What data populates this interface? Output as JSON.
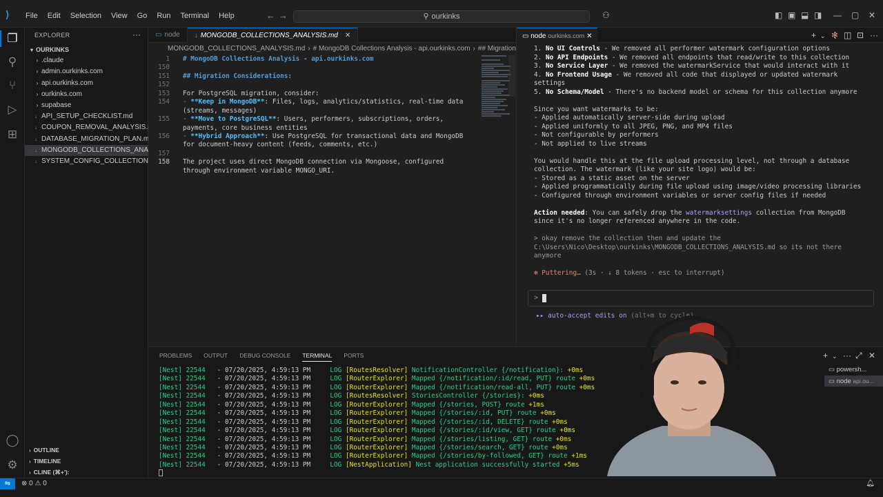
{
  "titlebar": {
    "menus": [
      "File",
      "Edit",
      "Selection",
      "View",
      "Go",
      "Run",
      "Terminal",
      "Help"
    ],
    "search": "ourkinks"
  },
  "sidebar": {
    "header": "EXPLORER",
    "root": "OURKINKS",
    "items": [
      {
        "label": ".claude",
        "type": "folder"
      },
      {
        "label": "admin.ourkinks.com",
        "type": "folder"
      },
      {
        "label": "api.ourkinks.com",
        "type": "folder"
      },
      {
        "label": "ourkinks.com",
        "type": "folder"
      },
      {
        "label": "supabase",
        "type": "folder"
      },
      {
        "label": "API_SETUP_CHECKLIST.md",
        "type": "file"
      },
      {
        "label": "COUPON_REMOVAL_ANALYSIS.md",
        "type": "file"
      },
      {
        "label": "DATABASE_MIGRATION_PLAN.md",
        "type": "file"
      },
      {
        "label": "MONGODB_COLLECTIONS_ANALY...",
        "type": "file",
        "selected": true
      },
      {
        "label": "SYSTEM_CONFIG_COLLECTIONS_A...",
        "type": "file"
      }
    ],
    "outline": "OUTLINE",
    "timeline": "TIMELINE",
    "cline": "CLINE (⌘+'):"
  },
  "editor": {
    "tabs": [
      {
        "label": "node",
        "active": false
      },
      {
        "label": "MONGODB_COLLECTIONS_ANALYSIS.md",
        "active": true
      }
    ],
    "breadcrumb": [
      "MONGODB_COLLECTIONS_ANALYSIS.md",
      "# MongoDB Collections Analysis - api.ourkinks.com",
      "## Migration C"
    ],
    "lines": [
      {
        "n": "1",
        "parts": [
          [
            "h",
            "# MongoDB Collections Analysis - api.ourkinks.com"
          ]
        ]
      },
      {
        "n": "150",
        "parts": [
          [
            "t",
            ""
          ]
        ]
      },
      {
        "n": "151",
        "parts": [
          [
            "h",
            "## Migration Considerations:"
          ]
        ]
      },
      {
        "n": "152",
        "parts": [
          [
            "t",
            ""
          ]
        ]
      },
      {
        "n": "153",
        "parts": [
          [
            "t",
            "For PostgreSQL migration, consider:"
          ]
        ]
      },
      {
        "n": "154",
        "parts": [
          [
            "b",
            "- "
          ],
          [
            "bold",
            "**Keep in MongoDB**"
          ],
          [
            "t",
            ": Files, logs, analytics/statistics, real-time data"
          ]
        ]
      },
      {
        "n": "",
        "parts": [
          [
            "t",
            "(streams, messages)"
          ]
        ]
      },
      {
        "n": "155",
        "parts": [
          [
            "b",
            "- "
          ],
          [
            "bold",
            "**Move to PostgreSQL**"
          ],
          [
            "t",
            ": Users, performers, subscriptions, orders,"
          ]
        ]
      },
      {
        "n": "",
        "parts": [
          [
            "t",
            "payments, core business entities"
          ]
        ]
      },
      {
        "n": "156",
        "parts": [
          [
            "b",
            "- "
          ],
          [
            "bold",
            "**Hybrid Approach**"
          ],
          [
            "t",
            ": Use PostgreSQL for transactional data and MongoDB"
          ]
        ]
      },
      {
        "n": "",
        "parts": [
          [
            "t",
            "for document-heavy content (feeds, comments, etc.)"
          ]
        ]
      },
      {
        "n": "157",
        "parts": [
          [
            "t",
            ""
          ]
        ]
      },
      {
        "n": "158",
        "cur": true,
        "parts": [
          [
            "t",
            "The project uses direct MongoDB connection via Mongoose, configured"
          ]
        ]
      },
      {
        "n": "",
        "parts": [
          [
            "t",
            "through environment variable MONGO_URI."
          ]
        ]
      }
    ]
  },
  "right_terminal": {
    "tab_label": "node",
    "tab_sub": "ourkinks.com",
    "lines": [
      [
        [
          "t",
          "1. "
        ],
        [
          "b",
          "No UI Controls"
        ],
        [
          "t",
          " - We removed all performer watermark configuration options"
        ]
      ],
      [
        [
          "t",
          "2. "
        ],
        [
          "b",
          "No API Endpoints"
        ],
        [
          "t",
          " - We removed all endpoints that read/write to this collection"
        ]
      ],
      [
        [
          "t",
          "3. "
        ],
        [
          "b",
          "No Service Layer"
        ],
        [
          "t",
          " - We removed the watermarkService that would interact with it"
        ]
      ],
      [
        [
          "t",
          "4. "
        ],
        [
          "b",
          "No Frontend Usage"
        ],
        [
          "t",
          " - We removed all code that displayed or updated watermark"
        ]
      ],
      [
        [
          "t",
          "settings"
        ]
      ],
      [
        [
          "t",
          "5. "
        ],
        [
          "b",
          "No Schema/Model"
        ],
        [
          "t",
          " - There's no backend model or schema for this collection anymore"
        ]
      ],
      [
        [
          "t",
          ""
        ]
      ],
      [
        [
          "t",
          "Since you want watermarks to be:"
        ]
      ],
      [
        [
          "t",
          "- Applied automatically server-side during upload"
        ]
      ],
      [
        [
          "t",
          "- Applied uniformly to all JPEG, PNG, and MP4 files"
        ]
      ],
      [
        [
          "t",
          "- Not configurable by performers"
        ]
      ],
      [
        [
          "t",
          "- Not applied to live streams"
        ]
      ],
      [
        [
          "t",
          ""
        ]
      ],
      [
        [
          "t",
          "You would handle this at the file upload processing level, not through a database"
        ]
      ],
      [
        [
          "t",
          "collection. The watermark (like your site logo) would be:"
        ]
      ],
      [
        [
          "t",
          "- Stored as a static asset on the server"
        ]
      ],
      [
        [
          "t",
          "- Applied programmatically during file upload using image/video processing libraries"
        ]
      ],
      [
        [
          "t",
          "- Configured through environment variables or server config files if needed"
        ]
      ],
      [
        [
          "t",
          ""
        ]
      ],
      [
        [
          "b",
          "Action needed"
        ],
        [
          "t",
          ": You can safely drop the "
        ],
        [
          "hl",
          "watermarksettings"
        ],
        [
          "t",
          " collection from MongoDB"
        ]
      ],
      [
        [
          "t",
          "since it's no longer referenced anywhere in the code."
        ]
      ],
      [
        [
          "t",
          ""
        ]
      ],
      [
        [
          "gr",
          "> okay remove the collection then and update the"
        ]
      ],
      [
        [
          "gr",
          "C:\\Users\\Nico\\Desktop\\ourkinks\\MONGODB_COLLECTIONS_ANALYSIS.md so its not there"
        ]
      ],
      [
        [
          "gr",
          "anymore"
        ]
      ],
      [
        [
          "t",
          ""
        ]
      ],
      [
        [
          "or",
          "✻ Puttering…"
        ],
        [
          "gr",
          " (3s · ↓ 8 tokens · esc to interrupt)"
        ]
      ]
    ],
    "prompt_symbol": ">",
    "auto_accept": "▸▸ auto-accept edits on",
    "auto_accept_hint": " (alt+m to cycle)"
  },
  "bottom_panel": {
    "tabs": [
      "PROBLEMS",
      "OUTPUT",
      "DEBUG CONSOLE",
      "TERMINAL",
      "PORTS"
    ],
    "active_tab": "TERMINAL",
    "terminals": [
      {
        "label": "powersh...",
        "active": false
      },
      {
        "label": "node",
        "sub": "api.ou...",
        "active": true
      }
    ],
    "log_lines": [
      {
        "pid": "[Nest] 22544",
        "time": "  - 07/20/2025, 4:59:13 PM",
        "ctx": "[RoutesResolver]",
        "msg": "NotificationController {/notification}:",
        "dur": "+0ms"
      },
      {
        "pid": "[Nest] 22544",
        "time": "  - 07/20/2025, 4:59:13 PM",
        "ctx": "[RouterExplorer]",
        "msg": "Mapped {/notification/:id/read, PUT} route",
        "dur": "+0ms"
      },
      {
        "pid": "[Nest] 22544",
        "time": "  - 07/20/2025, 4:59:13 PM",
        "ctx": "[RouterExplorer]",
        "msg": "Mapped {/notification/read-all, PUT} route",
        "dur": "+0ms"
      },
      {
        "pid": "[Nest] 22544",
        "time": "  - 07/20/2025, 4:59:13 PM",
        "ctx": "[RoutesResolver]",
        "msg": "StoriesController {/stories}:",
        "dur": "+0ms"
      },
      {
        "pid": "[Nest] 22544",
        "time": "  - 07/20/2025, 4:59:13 PM",
        "ctx": "[RouterExplorer]",
        "msg": "Mapped {/stories, POST} route",
        "dur": "+1ms"
      },
      {
        "pid": "[Nest] 22544",
        "time": "  - 07/20/2025, 4:59:13 PM",
        "ctx": "[RouterExplorer]",
        "msg": "Mapped {/stories/:id, PUT} route",
        "dur": "+0ms"
      },
      {
        "pid": "[Nest] 22544",
        "time": "  - 07/20/2025, 4:59:13 PM",
        "ctx": "[RouterExplorer]",
        "msg": "Mapped {/stories/:id, DELETE} route",
        "dur": "+0ms"
      },
      {
        "pid": "[Nest] 22544",
        "time": "  - 07/20/2025, 4:59:13 PM",
        "ctx": "[RouterExplorer]",
        "msg": "Mapped {/stories/:id/view, GET} route",
        "dur": "+0ms"
      },
      {
        "pid": "[Nest] 22544",
        "time": "  - 07/20/2025, 4:59:13 PM",
        "ctx": "[RouterExplorer]",
        "msg": "Mapped {/stories/listing, GET} route",
        "dur": "+0ms"
      },
      {
        "pid": "[Nest] 22544",
        "time": "  - 07/20/2025, 4:59:13 PM",
        "ctx": "[RouterExplorer]",
        "msg": "Mapped {/stories/search, GET} route",
        "dur": "+0ms"
      },
      {
        "pid": "[Nest] 22544",
        "time": "  - 07/20/2025, 4:59:13 PM",
        "ctx": "[RouterExplorer]",
        "msg": "Mapped {/stories/by-followed, GET} route",
        "dur": "+1ms"
      },
      {
        "pid": "[Nest] 22544",
        "time": "  - 07/20/2025, 4:59:13 PM",
        "ctx": "[NestApplication]",
        "msg": "Nest application successfully started",
        "dur": "+5ms"
      }
    ]
  },
  "statusbar": {
    "problems": "⊗ 0 ⚠ 0"
  },
  "colors": {
    "accent": "#0078d4",
    "log_green": "#23d18b",
    "log_yellow": "#e5e510",
    "claude_purple": "#b39af7"
  }
}
